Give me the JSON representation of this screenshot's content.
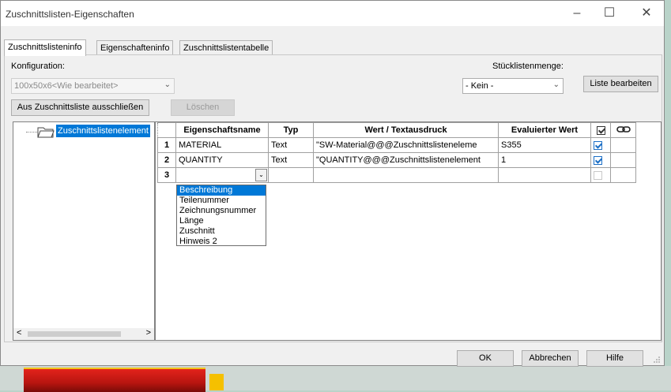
{
  "window": {
    "title": "Zuschnittslisten-Eigenschaften",
    "minimize_glyph": "–",
    "maximize_glyph": "☐",
    "close_glyph": "✕"
  },
  "tabs": [
    {
      "label": "Zuschnittslisteninfo",
      "active": true
    },
    {
      "label": "Eigenschafteninfo",
      "active": false
    },
    {
      "label": "Zuschnittslistentabelle",
      "active": false
    }
  ],
  "config": {
    "label": "Konfiguration:",
    "value": "100x50x6<Wie bearbeitet>"
  },
  "bom": {
    "label": "Stücklistenmenge:",
    "value": "- Kein -",
    "edit_button": "Liste bearbeiten"
  },
  "buttons": {
    "exclude": "Aus Zuschnittsliste ausschließen",
    "delete": "Löschen",
    "ok": "OK",
    "cancel": "Abbrechen",
    "help": "Hilfe"
  },
  "tree": {
    "item": "Zuschnittslistenelement",
    "scroll_left": "<",
    "scroll_right": ">"
  },
  "grid": {
    "headers": [
      "Eigenschaftsname",
      "Typ",
      "Wert / Textausdruck",
      "Evaluierter Wert"
    ],
    "rows": [
      {
        "num": "1",
        "name": "MATERIAL",
        "type": "Text",
        "value": "\"SW-Material@@@Zuschnittslisteneleme",
        "evaluated": "S355",
        "checked": true
      },
      {
        "num": "2",
        "name": "QUANTITY",
        "type": "Text",
        "value": "\"QUANTITY@@@Zuschnittslistenelement",
        "evaluated": "1",
        "checked": true
      },
      {
        "num": "3",
        "name": "",
        "type": "",
        "value": "",
        "evaluated": "",
        "checked": false
      }
    ]
  },
  "dropdown": {
    "options": [
      "Beschreibung",
      "Teilenummer",
      "Zeichnungsnummer",
      "Länge",
      "Zuschnitt",
      "Hinweis 2"
    ],
    "selected": "Beschreibung"
  },
  "colors": {
    "selection": "#0078d7",
    "checkbox": "#1c6fc6"
  }
}
